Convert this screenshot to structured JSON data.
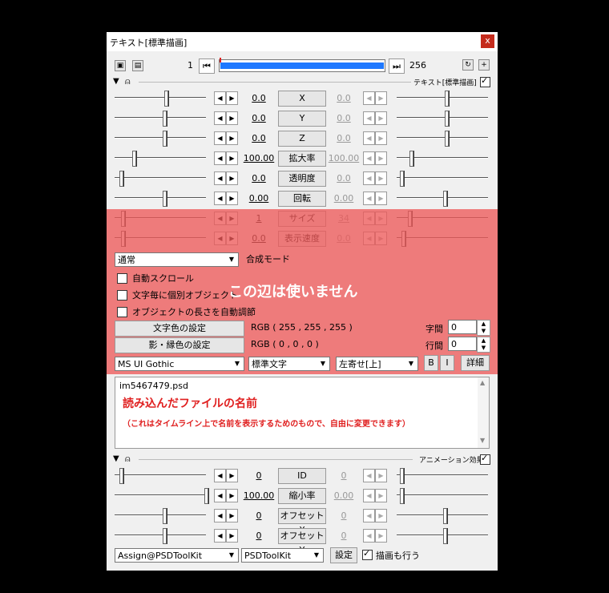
{
  "window": {
    "title": "テキスト[標準描画]",
    "close": "x"
  },
  "timeline": {
    "start": "1",
    "end": "256"
  },
  "std_section": {
    "label": "テキスト[標準描画]"
  },
  "params": [
    {
      "name": "X",
      "left": "0.0",
      "right": "0.0"
    },
    {
      "name": "Y",
      "left": "0.0",
      "right": "0.0"
    },
    {
      "name": "Z",
      "left": "0.0",
      "right": "0.0"
    },
    {
      "name": "拡大率",
      "left": "100.00",
      "right": "100.00"
    },
    {
      "name": "透明度",
      "left": "0.0",
      "right": "0.0"
    },
    {
      "name": "回転",
      "left": "0.00",
      "right": "0.00"
    },
    {
      "name": "サイズ",
      "left": "1",
      "right": "34"
    },
    {
      "name": "表示速度",
      "left": "0.0",
      "right": "0.0"
    }
  ],
  "blend": {
    "value": "通常",
    "label": "合成モード"
  },
  "checks": [
    "自動スクロール",
    "文字毎に個別オブジェクト",
    "オブジェクトの長さを自動調節"
  ],
  "notice": "この辺は使いません",
  "color1": {
    "button": "文字色の設定",
    "value": "RGB ( 255 , 255 , 255 )"
  },
  "color2": {
    "button": "影・縁色の設定",
    "value": "RGB ( 0 , 0 , 0 )"
  },
  "spacing": {
    "char_label": "字間",
    "char_value": "0",
    "line_label": "行間",
    "line_value": "0"
  },
  "font": {
    "family": "MS UI Gothic",
    "style": "標準文字",
    "align": "左寄せ[上]",
    "bold": "B",
    "italic": "I",
    "detail": "詳細"
  },
  "textarea": {
    "filename": "im5467479.psd",
    "note_title": "読み込んだファイルの名前",
    "note_body": "（これはタイムライン上で名前を表示するためのもので、自由に変更できます）"
  },
  "anim": {
    "label": "アニメーション効果"
  },
  "anim_params": [
    {
      "name": "ID",
      "left": "0",
      "right": "0"
    },
    {
      "name": "縮小率",
      "left": "100.00",
      "right": "0.00"
    },
    {
      "name": "オフセットX",
      "left": "0",
      "right": "0"
    },
    {
      "name": "オフセットY",
      "left": "0",
      "right": "0"
    }
  ],
  "bottom": {
    "script": "Assign@PSDToolKit",
    "category": "PSDToolKit",
    "settings": "設定",
    "draw_label": "描画も行う"
  },
  "colors": {
    "overlay": "#ed5a5a",
    "accent": "#e02020",
    "timeline": "#1e78ff"
  }
}
